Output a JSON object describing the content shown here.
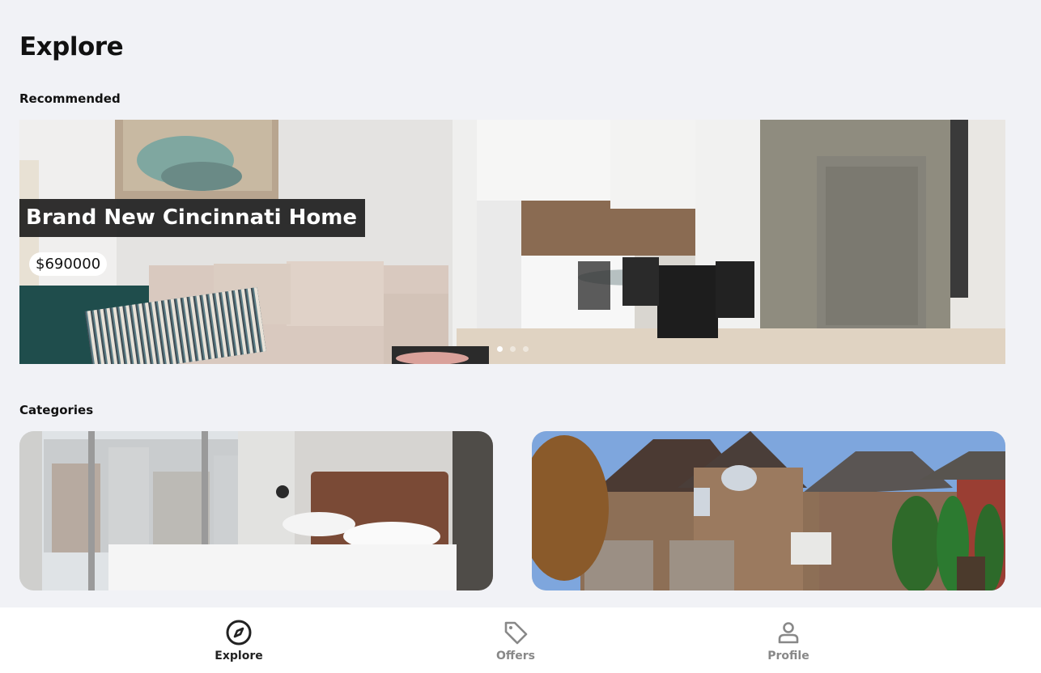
{
  "page": {
    "title": "Explore"
  },
  "recommended": {
    "label": "Recommended",
    "slides_count": 3,
    "active_slide": 1,
    "featured": {
      "title": "Brand New Cincinnati Home",
      "price": "$690000"
    }
  },
  "categories": {
    "label": "Categories",
    "items": [
      {
        "icon": "apartment-bedroom-photo"
      },
      {
        "icon": "house-exterior-photo"
      }
    ]
  },
  "bottom_nav": {
    "items": [
      {
        "label": "Explore",
        "icon": "compass-icon",
        "active": true
      },
      {
        "label": "Offers",
        "icon": "tag-icon",
        "active": false
      },
      {
        "label": "Profile",
        "icon": "person-icon",
        "active": false
      }
    ]
  },
  "colors": {
    "background": "#f1f2f6",
    "nav_active": "#222222",
    "nav_inactive": "#888888"
  }
}
